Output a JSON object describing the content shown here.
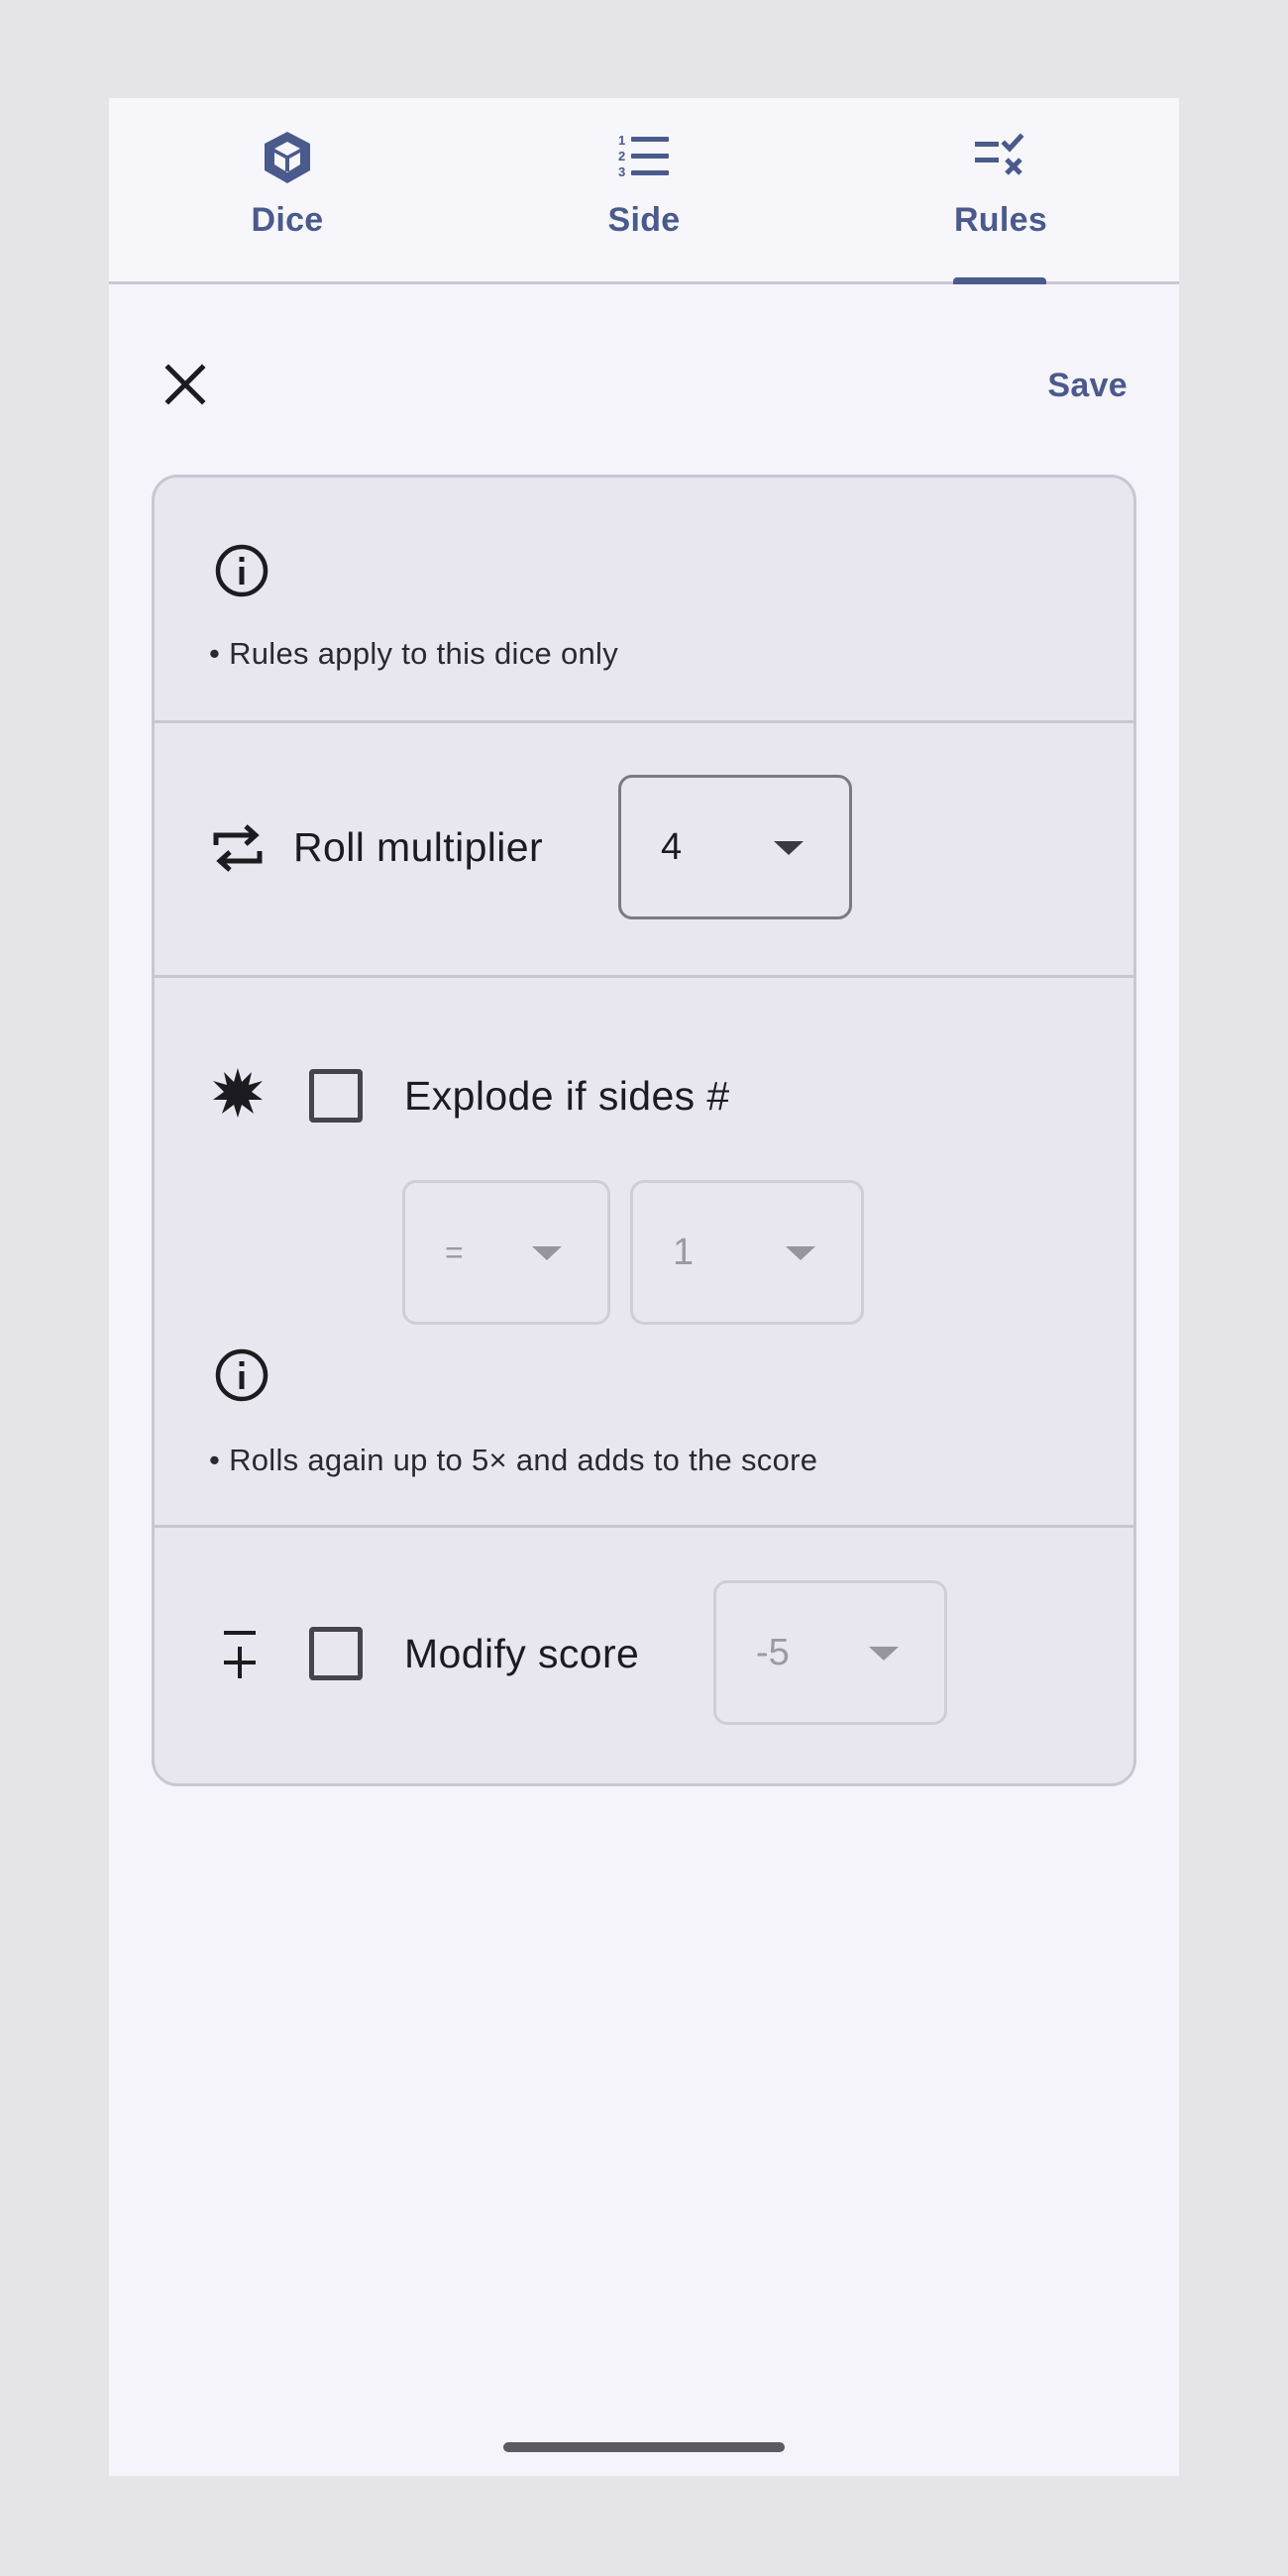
{
  "tabs": [
    {
      "label": "Dice",
      "icon": "cube-icon",
      "selected": false
    },
    {
      "label": "Side",
      "icon": "numbered-list-icon",
      "selected": false
    },
    {
      "label": "Rules",
      "icon": "rules-checklist-icon",
      "selected": true
    }
  ],
  "actions": {
    "close_icon": "close-icon",
    "save_label": "Save"
  },
  "rules": {
    "info": {
      "icon": "info-icon",
      "text": "• Rules apply to this dice only"
    },
    "roll_multiplier": {
      "icon": "repeat-icon",
      "label": "Roll multiplier",
      "value": "4"
    },
    "explode": {
      "icon": "explosion-icon",
      "checked": false,
      "label": "Explode if sides #",
      "operator": "=",
      "side_value": "1",
      "info_icon": "info-icon",
      "info_text": "• Rolls again up to 5× and adds to the score"
    },
    "modify_score": {
      "icon": "plus-minus-icon",
      "checked": false,
      "label": "Modify score",
      "value": "-5"
    }
  },
  "colors": {
    "accent": "#4a5a8c",
    "card_background": "#e8e7f0",
    "page_background": "#f4f4fa"
  }
}
